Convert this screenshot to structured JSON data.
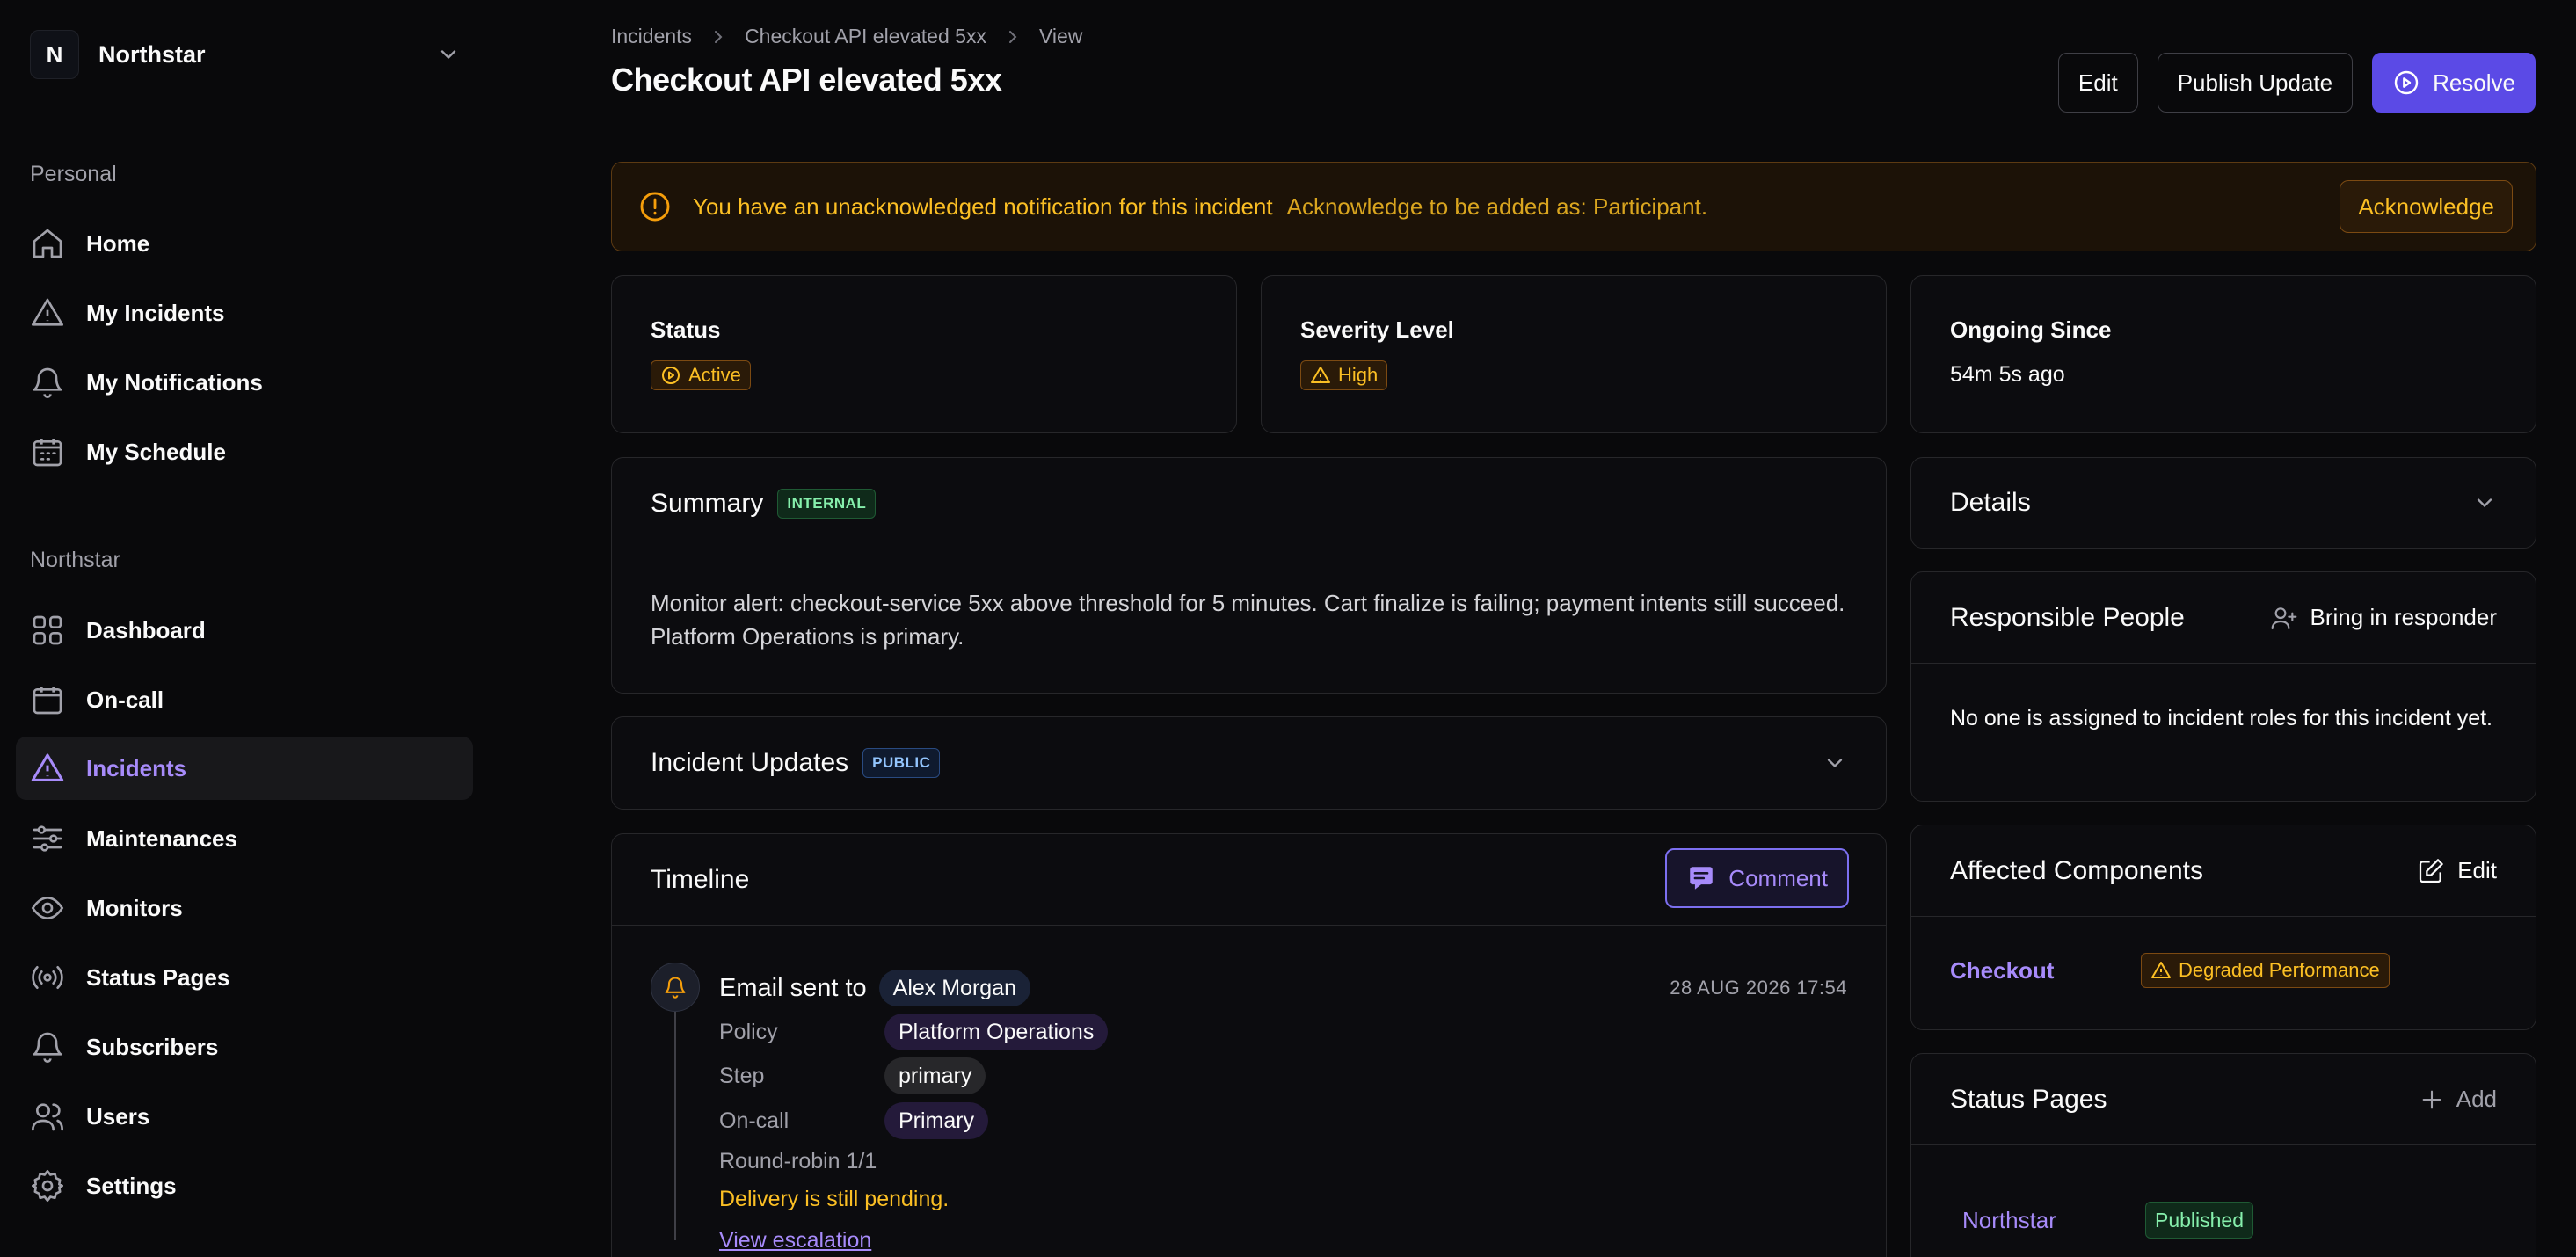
{
  "sidebar": {
    "org": {
      "initial": "N",
      "name": "Northstar"
    },
    "personal_title": "Personal",
    "personal_items": [
      {
        "label": "Home",
        "icon": "home-icon"
      },
      {
        "label": "My Incidents",
        "icon": "alert-triangle-icon"
      },
      {
        "label": "My Notifications",
        "icon": "bell-icon"
      },
      {
        "label": "My Schedule",
        "icon": "calendar-icon"
      }
    ],
    "org_title": "Northstar",
    "org_items": [
      {
        "label": "Dashboard",
        "icon": "grid-icon"
      },
      {
        "label": "On-call",
        "icon": "calendar-icon"
      },
      {
        "label": "Incidents",
        "icon": "alert-triangle-icon",
        "active": true
      },
      {
        "label": "Maintenances",
        "icon": "sliders-icon"
      },
      {
        "label": "Monitors",
        "icon": "eye-icon"
      },
      {
        "label": "Status Pages",
        "icon": "broadcast-icon"
      },
      {
        "label": "Subscribers",
        "icon": "bell-icon"
      },
      {
        "label": "Users",
        "icon": "users-icon"
      },
      {
        "label": "Settings",
        "icon": "gear-icon"
      }
    ]
  },
  "header": {
    "breadcrumb": [
      "Incidents",
      "Checkout API elevated 5xx",
      "View"
    ],
    "title": "Checkout API elevated 5xx",
    "actions": {
      "edit": "Edit",
      "publish": "Publish Update",
      "resolve": "Resolve"
    }
  },
  "notice": {
    "title": "You have an unacknowledged notification for this incident",
    "subtitle": "Acknowledge to be added as: Participant.",
    "button": "Acknowledge"
  },
  "stats": {
    "status": {
      "label": "Status",
      "value": "Active"
    },
    "severity": {
      "label": "Severity Level",
      "value": "High"
    },
    "ongoing": {
      "label": "Ongoing Since",
      "value": "54m 5s ago"
    }
  },
  "summary": {
    "title": "Summary",
    "tag": "INTERNAL",
    "text": "Monitor alert: checkout-service 5xx above threshold for 5 minutes. Cart finalize is failing; payment intents still succeed. Platform Operations is primary."
  },
  "updates": {
    "title": "Incident Updates",
    "tag": "PUBLIC"
  },
  "timeline": {
    "title": "Timeline",
    "comment_button": "Comment",
    "entry": {
      "title_prefix": "Email sent to",
      "recipient": "Alex Morgan",
      "time": "28 AUG 2026 17:54",
      "policy_label": "Policy",
      "policy": "Platform Operations",
      "step_label": "Step",
      "step": "primary",
      "oncall_label": "On-call",
      "oncall": "Primary",
      "rotation": "Round-robin 1/1",
      "pending": "Delivery is still pending.",
      "link": "View escalation"
    }
  },
  "details": {
    "title": "Details"
  },
  "responsible": {
    "title": "Responsible People",
    "action": "Bring in responder",
    "empty": "No one is assigned to incident roles for this incident yet."
  },
  "components": {
    "title": "Affected Components",
    "action": "Edit",
    "items": [
      {
        "name": "Checkout",
        "status": "Degraded Performance"
      }
    ]
  },
  "status_pages": {
    "title": "Status Pages",
    "action": "Add",
    "items": [
      {
        "name": "Northstar",
        "status": "Published"
      }
    ]
  },
  "colors": {
    "accent": "#a78bfa",
    "primary_button": "#5b4ae6",
    "warning": "#fbbf24",
    "success": "#86efac"
  }
}
